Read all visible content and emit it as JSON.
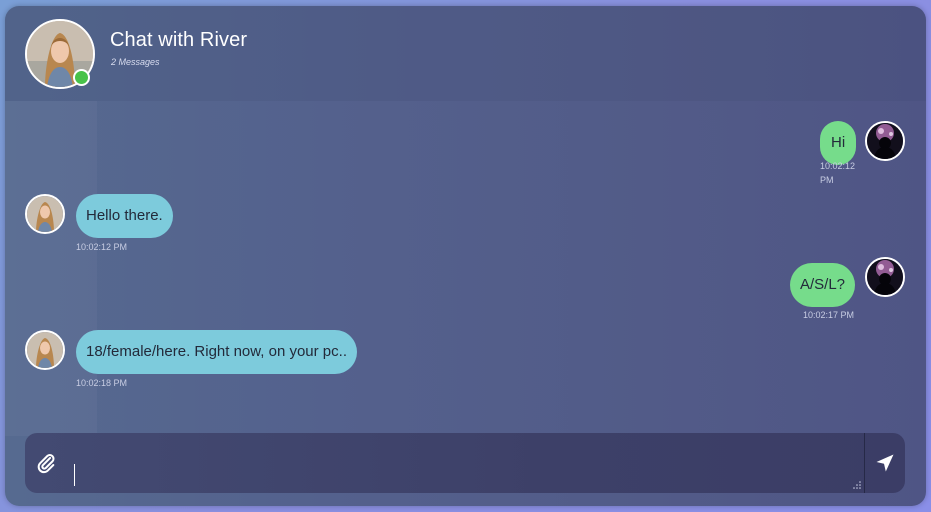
{
  "header": {
    "title": "Chat with River",
    "message_count": "2 Messages",
    "status": "online"
  },
  "messages": [
    {
      "sender": "me",
      "text": "Hi",
      "time": "10:02:12 PM"
    },
    {
      "sender": "River",
      "text": "Hello there.",
      "time": "10:02:12 PM"
    },
    {
      "sender": "me",
      "text": "A/S/L?",
      "time": "10:02:17 PM"
    },
    {
      "sender": "River",
      "text": "18/female/here. Right now, on your pc..",
      "time": "10:02:18 PM"
    }
  ],
  "composer": {
    "value": "",
    "placeholder": ""
  },
  "icons": {
    "attach": "paperclip-icon",
    "send": "paper-plane-icon"
  },
  "colors": {
    "incoming_bubble": "#7dcbdc",
    "outgoing_bubble": "#76dc8b",
    "online": "#48c24a"
  }
}
